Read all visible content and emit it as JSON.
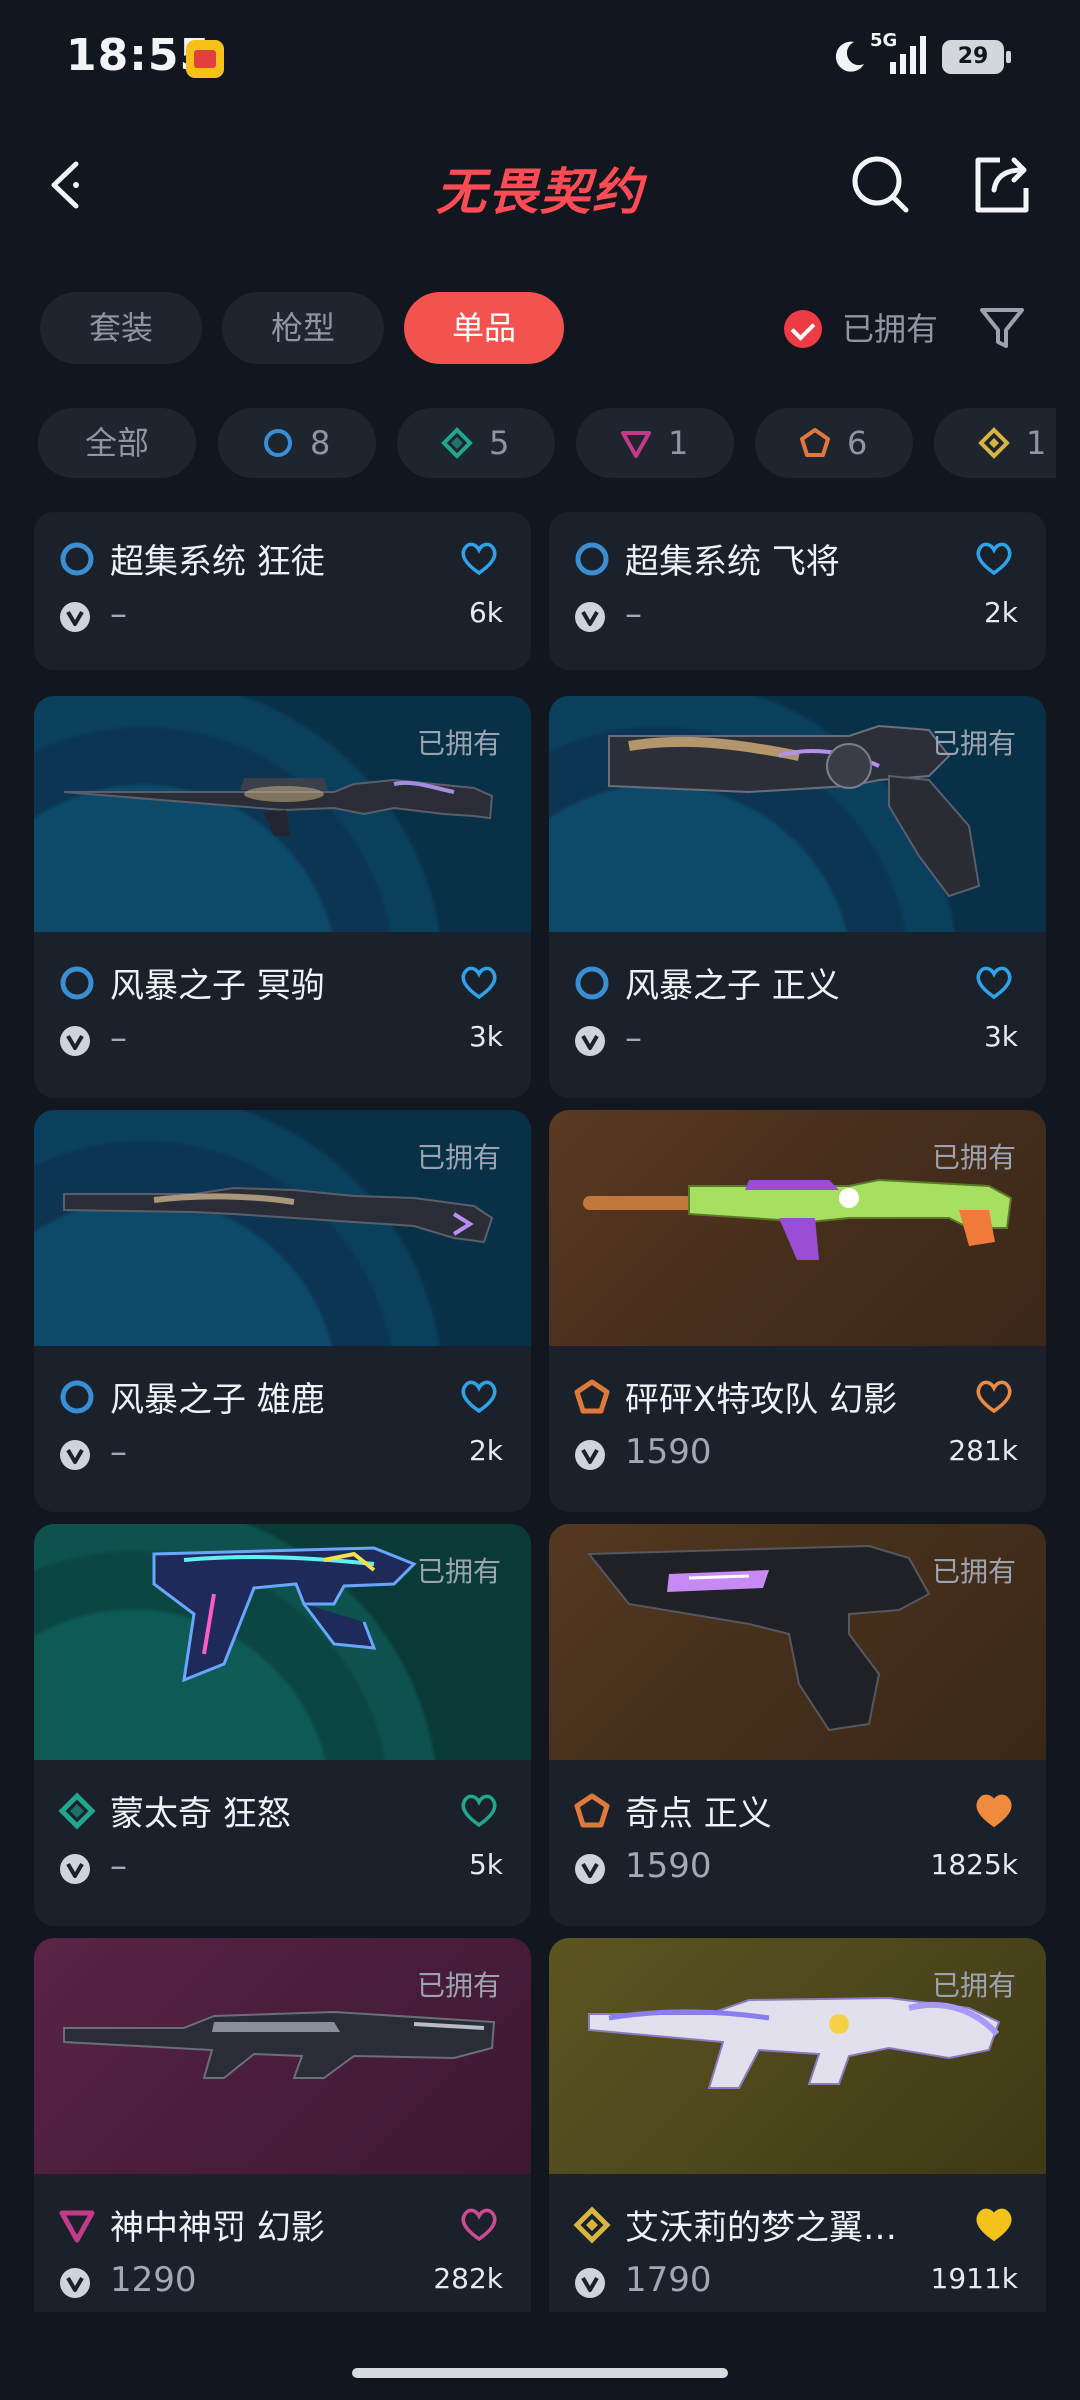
{
  "status_bar": {
    "time": "18:55",
    "network": "5G",
    "battery": "29",
    "icons": [
      "app-notification-icon",
      "moon-icon",
      "signal-icon",
      "battery-icon"
    ]
  },
  "header": {
    "title": "无畏契约",
    "icons": [
      "back-icon",
      "search-icon",
      "share-icon"
    ],
    "title_color": "#ff4b55"
  },
  "tabs": [
    {
      "label": "套装"
    },
    {
      "label": "枪型"
    },
    {
      "label": "单品"
    }
  ],
  "active_tab": "单品",
  "owned_filter": {
    "label": "已拥有",
    "checked": true
  },
  "filter_icon": "funnel-icon",
  "tier_chips": [
    {
      "label": "全部"
    },
    {
      "tier": "select",
      "count": "8",
      "color": "#3a8fd4"
    },
    {
      "tier": "deluxe",
      "count": "5",
      "color": "#1fa88f"
    },
    {
      "tier": "premium",
      "count": "1",
      "color": "#c23b8b"
    },
    {
      "tier": "exclusive",
      "count": "6",
      "color": "#e07a3b"
    },
    {
      "tier": "ultra",
      "count": "1",
      "color": "#d8b540"
    }
  ],
  "cards": [
    {
      "name": "超集系统 狂徒",
      "tier": "select",
      "price": "–",
      "likes": "6k",
      "liked": false,
      "heart_color": "#2fa2e8"
    },
    {
      "name": "超集系统 飞将",
      "tier": "select",
      "price": "–",
      "likes": "2k",
      "liked": false,
      "heart_color": "#2fa2e8"
    },
    {
      "name": "风暴之子 冥驹",
      "tier": "select",
      "price": "–",
      "likes": "3k",
      "liked": false,
      "owned": "已拥有",
      "heart_color": "#2fa2e8"
    },
    {
      "name": "风暴之子 正义",
      "tier": "select",
      "price": "–",
      "likes": "3k",
      "liked": false,
      "owned": "已拥有",
      "heart_color": "#2fa2e8"
    },
    {
      "name": "风暴之子 雄鹿",
      "tier": "select",
      "price": "–",
      "likes": "2k",
      "liked": false,
      "owned": "已拥有",
      "heart_color": "#2fa2e8"
    },
    {
      "name": "砰砰X特攻队 幻影",
      "tier": "exclusive",
      "price": "1590",
      "likes": "281k",
      "liked": false,
      "owned": "已拥有",
      "heart_color": "#e98a45"
    },
    {
      "name": "蒙太奇 狂怒",
      "tier": "deluxe",
      "price": "–",
      "likes": "5k",
      "liked": false,
      "owned": "已拥有",
      "heart_color": "#1fa88f"
    },
    {
      "name": "奇点 正义",
      "tier": "exclusive",
      "price": "1590",
      "likes": "1825k",
      "liked": true,
      "owned": "已拥有",
      "heart_color": "#f08a3c"
    },
    {
      "name": "神中神罚 幻影",
      "tier": "premium",
      "price": "1290",
      "likes": "282k",
      "liked": false,
      "owned": "已拥有",
      "heart_color": "#d04a93"
    },
    {
      "name": "艾沃莉的梦之翼…",
      "tier": "ultra",
      "price": "1790",
      "likes": "1911k",
      "liked": true,
      "owned": "已拥有",
      "heart_color": "#f4c21a"
    }
  ]
}
